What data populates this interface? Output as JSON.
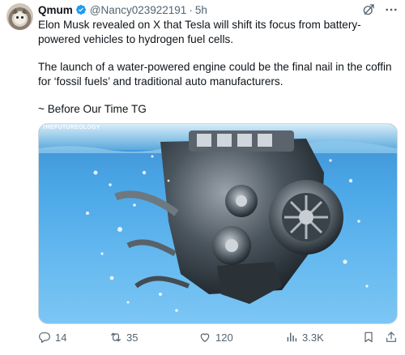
{
  "author": {
    "display_name": "Qmum",
    "handle": "@Nancy023922191",
    "separator": "·",
    "time": "5h",
    "avatar_icon": "cat-avatar",
    "verified_icon": "verified-badge-icon",
    "verified_color": "#1d9bf0"
  },
  "tweet": {
    "paragraphs": [
      "Elon Musk revealed on X that Tesla will shift its focus from battery-powered vehicles to hydrogen fuel cells.",
      "The launch of a water-powered engine could be the final nail in the coffin for ‘fossil fuels’ and traditional auto manufacturers.",
      "~ Before Our Time TG"
    ]
  },
  "media": {
    "watermark": "THEFUTUREOLOGY",
    "description_icon": "engine-underwater-image"
  },
  "actions": {
    "replies": "14",
    "reposts": "35",
    "likes": "120",
    "views": "3.3K"
  },
  "colors": {
    "text": "#0f1419",
    "secondary": "#536471",
    "accent": "#1d9bf0"
  }
}
